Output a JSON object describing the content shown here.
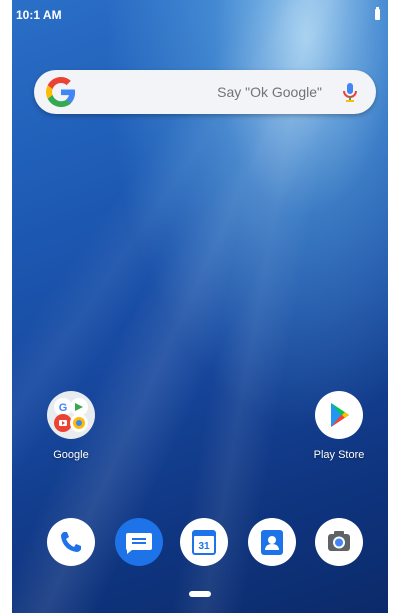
{
  "status_bar": {
    "time": "10:1 AM",
    "battery_icon": "battery-icon"
  },
  "search": {
    "placeholder": "Say \"Ok Google\"",
    "logo_icon": "google-g-icon",
    "mic_icon": "microphone-icon"
  },
  "home_apps": [
    {
      "label": "Google",
      "icon": "google-folder-icon"
    },
    {
      "label": "Play Store",
      "icon": "play-store-icon"
    }
  ],
  "dock": [
    {
      "icon": "phone-icon"
    },
    {
      "icon": "messages-icon"
    },
    {
      "icon": "calendar-icon",
      "text": "31"
    },
    {
      "icon": "contacts-icon"
    },
    {
      "icon": "camera-icon"
    }
  ],
  "nav": {
    "home_icon": "home-pill-icon"
  },
  "colors": {
    "wallpaper_top": "#2b6fc7",
    "wallpaper_bottom": "#0b2a6a",
    "dock_blue": "#1e73e8",
    "play_green": "#00c853",
    "play_yellow": "#ffc107",
    "play_red": "#f44336",
    "play_blue": "#2196f3"
  }
}
